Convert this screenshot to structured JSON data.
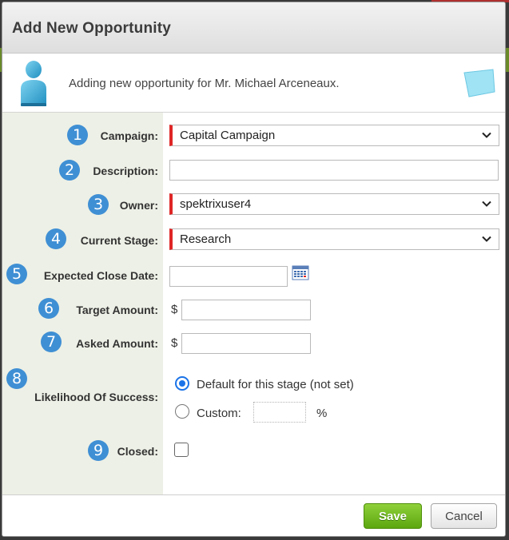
{
  "dialog": {
    "title": "Add New Opportunity",
    "info_message": "Adding new opportunity for Mr. Michael Arceneaux."
  },
  "fields": {
    "campaign": {
      "number": "1",
      "label": "Campaign:",
      "value": "Capital Campaign"
    },
    "description": {
      "number": "2",
      "label": "Description:",
      "value": ""
    },
    "owner": {
      "number": "3",
      "label": "Owner:",
      "value": "spektrixuser4"
    },
    "current_stage": {
      "number": "4",
      "label": "Current Stage:",
      "value": "Research"
    },
    "expected_close_date": {
      "number": "5",
      "label": "Expected Close Date:",
      "value": ""
    },
    "target_amount": {
      "number": "6",
      "label": "Target Amount:",
      "currency": "$",
      "value": ""
    },
    "asked_amount": {
      "number": "7",
      "label": "Asked Amount:",
      "currency": "$",
      "value": ""
    },
    "likelihood": {
      "number": "8",
      "label": "Likelihood Of Success:",
      "option_default": "Default for this stage (not set)",
      "option_custom": "Custom:",
      "percent_sign": "%",
      "selected": "default"
    },
    "closed": {
      "number": "9",
      "label": "Closed:",
      "checked": false
    }
  },
  "footer": {
    "save_label": "Save",
    "cancel_label": "Cancel"
  },
  "colors": {
    "required_marker": "#e02626",
    "number_badge": "#3f8fd4",
    "save_button": "#6fb81e",
    "label_column": "#edf0e6"
  },
  "icons": {
    "person": "person-icon",
    "note": "sticky-note-icon",
    "calendar": "calendar-icon",
    "dropdown": "chevron-down-icon"
  }
}
